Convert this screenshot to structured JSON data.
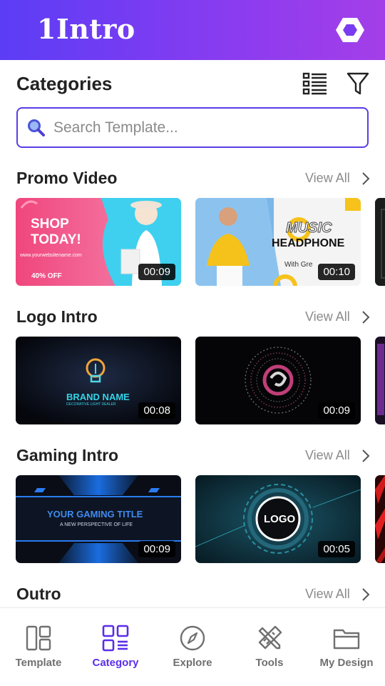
{
  "app": {
    "logo_text": "1Intro"
  },
  "header": {
    "settings_icon": "hexagon-icon"
  },
  "categories": {
    "title": "Categories",
    "list_icon": "list-view-icon",
    "filter_icon": "filter-icon"
  },
  "search": {
    "placeholder": "Search Template...",
    "value": ""
  },
  "sections": [
    {
      "title": "Promo Video",
      "view_all": "View All",
      "cards": [
        {
          "duration": "00:09",
          "thumb_text": [
            "SHOP",
            "TODAY!"
          ],
          "thumb_sub": "www.yourwebsitename.com",
          "thumb_badge": "40% OFF"
        },
        {
          "duration": "00:10",
          "thumb_text": [
            "MUSIC",
            "HEADPHONE"
          ],
          "thumb_sub": "With Gre"
        }
      ]
    },
    {
      "title": "Logo Intro",
      "view_all": "View All",
      "cards": [
        {
          "duration": "00:08",
          "thumb_text": [
            "BRAND NAME"
          ],
          "thumb_sub": "DECORATIVE LIGHT DEALER"
        },
        {
          "duration": "00:09"
        }
      ]
    },
    {
      "title": "Gaming Intro",
      "view_all": "View All",
      "cards": [
        {
          "duration": "00:09",
          "thumb_text": [
            "YOUR GAMING TITLE"
          ],
          "thumb_sub": "A NEW PERSPECTIVE OF LIFE"
        },
        {
          "duration": "00:05",
          "thumb_text": [
            "LOGO"
          ]
        }
      ]
    },
    {
      "title": "Outro",
      "view_all": "View All",
      "cards": []
    }
  ],
  "bottom_nav": {
    "items": [
      {
        "label": "Template",
        "icon": "template-layout-icon",
        "active": false
      },
      {
        "label": "Category",
        "icon": "category-grid-icon",
        "active": true
      },
      {
        "label": "Explore",
        "icon": "compass-icon",
        "active": false
      },
      {
        "label": "Tools",
        "icon": "tools-icon",
        "active": false
      },
      {
        "label": "My Design",
        "icon": "folder-icon",
        "active": false
      }
    ]
  },
  "colors": {
    "header_gradient_start": "#5b3df5",
    "header_gradient_end": "#a43ee8",
    "accent": "#5b2ee8",
    "inactive": "#707070"
  }
}
